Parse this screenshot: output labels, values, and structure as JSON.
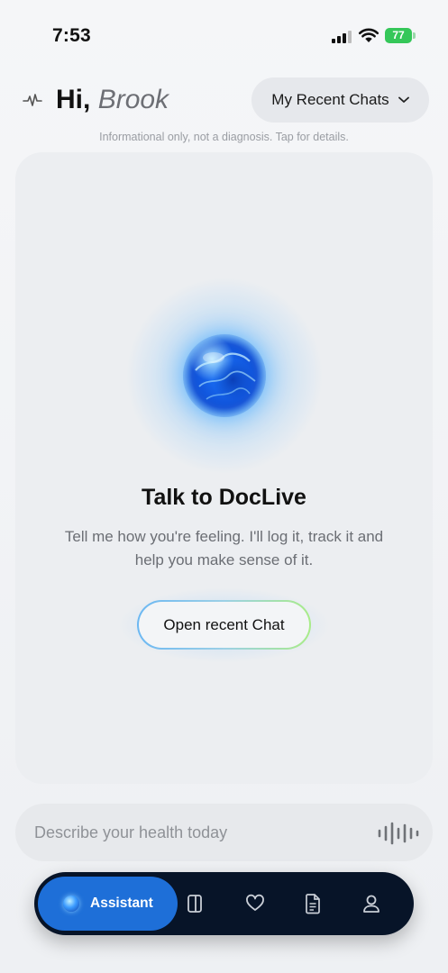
{
  "status_bar": {
    "time": "7:53",
    "battery": "77",
    "battery_color": "#35c759"
  },
  "header": {
    "greeting": "Hi,",
    "name": "Brook",
    "recent_chats_label": "My Recent Chats",
    "disclaimer": "Informational only, not a diagnosis. Tap for details."
  },
  "hero": {
    "title": "Talk to DocLive",
    "subtitle_line1": "Tell me how you're feeling. I'll log it, track it and",
    "subtitle_line2": "help you make sense of it.",
    "open_chat_label": "Open recent Chat"
  },
  "input": {
    "placeholder": "Describe your health today"
  },
  "tabbar": {
    "active_label": "Assistant",
    "accent": "#1e6fd8",
    "background": "#071428",
    "tabs": [
      {
        "icon": "assistant-orb-icon"
      },
      {
        "icon": "journal-icon"
      },
      {
        "icon": "heart-icon"
      },
      {
        "icon": "document-icon"
      },
      {
        "icon": "profile-icon"
      }
    ]
  }
}
